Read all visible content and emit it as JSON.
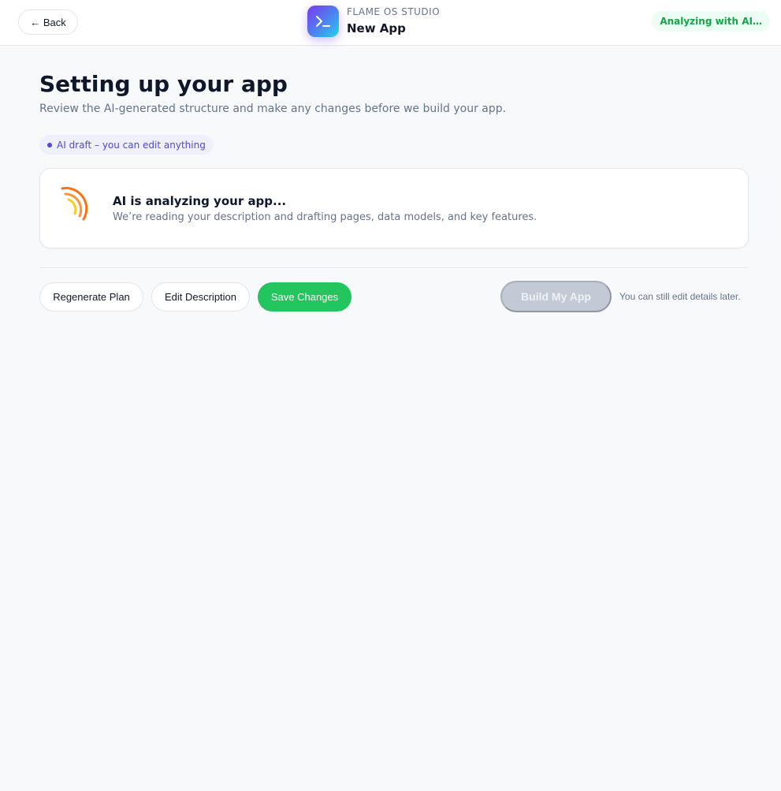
{
  "header": {
    "back_label": "← Back",
    "brand_eyebrow": "FLAME OS STUDIO",
    "brand_title": "New App",
    "status": "Analyzing with AI…"
  },
  "main": {
    "title": "Setting up your app",
    "subtitle": "Review the AI-generated structure and make any changes before we build your app.",
    "draft_badge": "AI draft – you can edit anything",
    "analysis_card": {
      "title": "AI is analyzing your app...",
      "description": "We’re reading your description and drafting pages, data models, and key features."
    }
  },
  "actions": {
    "regenerate_label": "Regenerate Plan",
    "edit_label": "Edit Description",
    "save_label": "Save Changes",
    "build_label": "Build My App",
    "build_hint": "You can still edit details later."
  },
  "colors": {
    "accent_green": "#22c55e",
    "accent_indigo": "#4f46e5",
    "spinner_outer": "#f97316",
    "spinner_inner": "#facc15"
  },
  "icons": {
    "brand": "terminal-prompt-icon",
    "spinner": "loading-arcs-icon"
  }
}
